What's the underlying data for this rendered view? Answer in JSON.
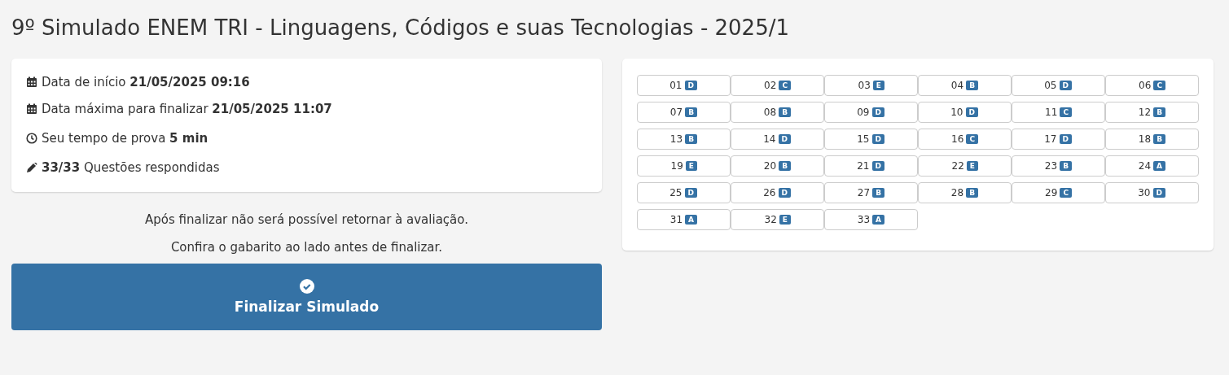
{
  "title": "9º Simulado ENEM TRI - Linguagens, Códigos e suas Tecnologias - 2025/1",
  "info": [
    {
      "kind": "calendar",
      "text": "Data de início **21/05/2025 09:16**"
    },
    {
      "kind": "calendar",
      "text": "Data máxima para finalizar **21/05/2025 11:07**"
    },
    {
      "kind": "clock",
      "text": "Seu tempo de prova **5 min**"
    },
    {
      "kind": "pencil",
      "text": "**33/33** Questões respondidas"
    }
  ],
  "notes": [
    "Após finalizar não será possível retornar à avaliação.",
    "Confira o gabarito ao lado antes de finalizar."
  ],
  "finish_button": "Finalizar Simulado",
  "answers": [
    {
      "number": "01",
      "answer": "D"
    },
    {
      "number": "02",
      "answer": "C"
    },
    {
      "number": "03",
      "answer": "E"
    },
    {
      "number": "04",
      "answer": "B"
    },
    {
      "number": "05",
      "answer": "D"
    },
    {
      "number": "06",
      "answer": "C"
    },
    {
      "number": "07",
      "answer": "B"
    },
    {
      "number": "08",
      "answer": "B"
    },
    {
      "number": "09",
      "answer": "D"
    },
    {
      "number": "10",
      "answer": "D"
    },
    {
      "number": "11",
      "answer": "C"
    },
    {
      "number": "12",
      "answer": "B"
    },
    {
      "number": "13",
      "answer": "B"
    },
    {
      "number": "14",
      "answer": "D"
    },
    {
      "number": "15",
      "answer": "D"
    },
    {
      "number": "16",
      "answer": "C"
    },
    {
      "number": "17",
      "answer": "D"
    },
    {
      "number": "18",
      "answer": "B"
    },
    {
      "number": "19",
      "answer": "E"
    },
    {
      "number": "20",
      "answer": "B"
    },
    {
      "number": "21",
      "answer": "D"
    },
    {
      "number": "22",
      "answer": "E"
    },
    {
      "number": "23",
      "answer": "B"
    },
    {
      "number": "24",
      "answer": "A"
    },
    {
      "number": "25",
      "answer": "D"
    },
    {
      "number": "26",
      "answer": "D"
    },
    {
      "number": "27",
      "answer": "B"
    },
    {
      "number": "28",
      "answer": "B"
    },
    {
      "number": "29",
      "answer": "C"
    },
    {
      "number": "30",
      "answer": "D"
    },
    {
      "number": "31",
      "answer": "A"
    },
    {
      "number": "32",
      "answer": "E"
    },
    {
      "number": "33",
      "answer": "A"
    }
  ]
}
